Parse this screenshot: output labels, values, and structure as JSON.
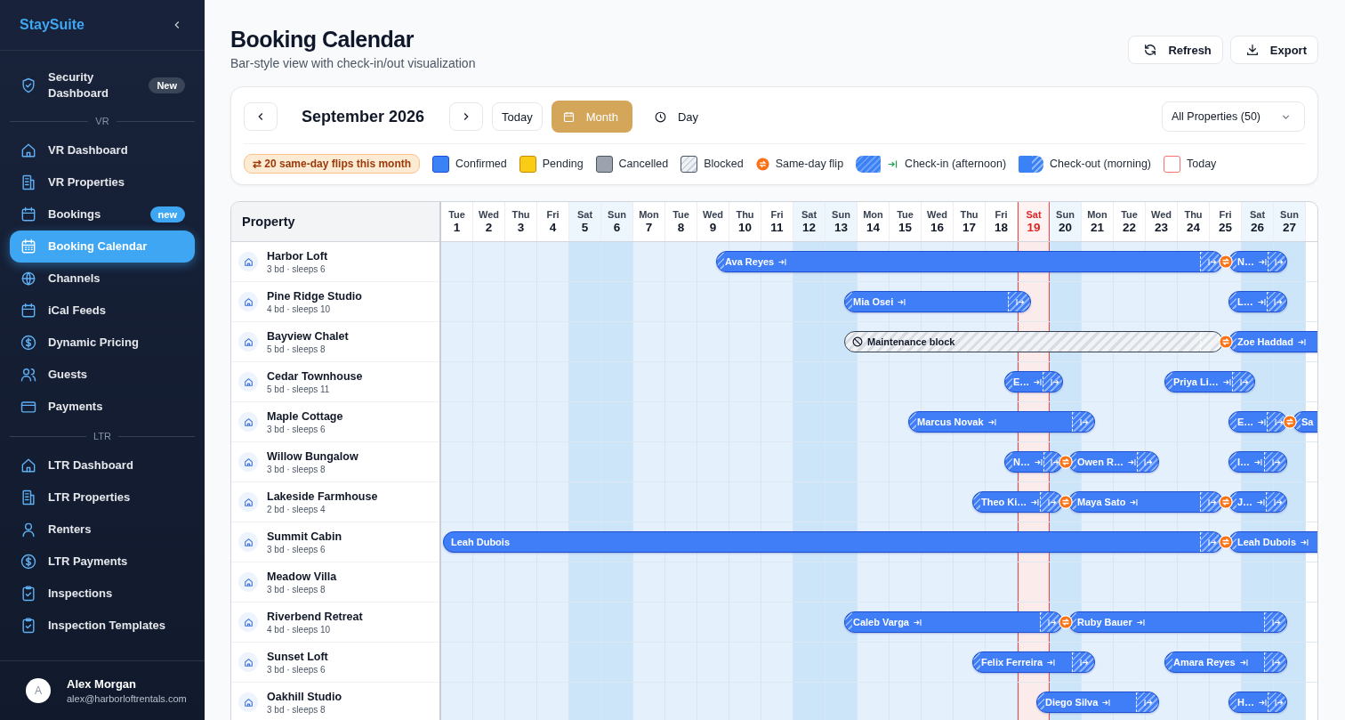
{
  "sidebar": {
    "brand": "StaySuite",
    "groups": [
      {
        "items": [
          {
            "label": "Security Dashboard",
            "selected": false,
            "badge": {
              "text": "New",
              "color": "#3a4558"
            }
          }
        ]
      },
      {
        "heading": "VR",
        "items": [
          {
            "label": "VR Dashboard",
            "selected": false
          },
          {
            "label": "VR Properties",
            "selected": false
          },
          {
            "label": "Bookings",
            "selected": false,
            "badge": {
              "text": "new",
              "color": "#3ea6f2"
            }
          },
          {
            "label": "Booking Calendar",
            "selected": true
          },
          {
            "label": "Channels",
            "selected": false
          },
          {
            "label": "iCal Feeds",
            "selected": false
          },
          {
            "label": "Dynamic Pricing",
            "selected": false
          },
          {
            "label": "Guests",
            "selected": false
          },
          {
            "label": "Payments",
            "selected": false
          }
        ]
      },
      {
        "heading": "LTR",
        "items": [
          {
            "label": "LTR Dashboard",
            "selected": false
          },
          {
            "label": "LTR Properties",
            "selected": false
          },
          {
            "label": "Renters",
            "selected": false
          },
          {
            "label": "LTR Payments",
            "selected": false
          },
          {
            "label": "Inspections",
            "selected": false
          },
          {
            "label": "Inspection Templates",
            "selected": false
          }
        ]
      }
    ],
    "user": {
      "initial": "A",
      "name": "Alex Morgan",
      "email": "alex@harborloftrentals.com"
    }
  },
  "header": {
    "title": "Booking Calendar",
    "subtitle": "Bar-style view with check-in/out visualization",
    "actions": [
      "Refresh",
      "Export"
    ]
  },
  "toolbar": {
    "month": "September 2026",
    "today": "Today",
    "views": [
      {
        "label": "Month",
        "selected": true
      },
      {
        "label": "Day",
        "selected": false
      }
    ],
    "filter": "All Properties (50)",
    "flips": "⇄ 20 same-day flips this month",
    "legend": [
      {
        "kind": "confirmed",
        "label": "Confirmed"
      },
      {
        "kind": "pending",
        "label": "Pending"
      },
      {
        "kind": "cancelled",
        "label": "Cancelled"
      },
      {
        "kind": "blocked",
        "label": "Blocked"
      },
      {
        "kind": "flip",
        "label": "Same-day flip"
      },
      {
        "kind": "checkin",
        "label": "Check-in (afternoon)"
      },
      {
        "kind": "checkout",
        "label": "Check-out (morning)"
      },
      {
        "kind": "today",
        "label": "Today"
      }
    ]
  },
  "calendar": {
    "property_heading": "Property",
    "days": [
      {
        "dow": "Tue",
        "date": "1",
        "weekend": false,
        "today": false
      },
      {
        "dow": "Wed",
        "date": "2",
        "weekend": false,
        "today": false
      },
      {
        "dow": "Thu",
        "date": "3",
        "weekend": false,
        "today": false
      },
      {
        "dow": "Fri",
        "date": "4",
        "weekend": false,
        "today": false
      },
      {
        "dow": "Sat",
        "date": "5",
        "weekend": true,
        "today": false
      },
      {
        "dow": "Sun",
        "date": "6",
        "weekend": true,
        "today": false
      },
      {
        "dow": "Mon",
        "date": "7",
        "weekend": false,
        "today": false
      },
      {
        "dow": "Tue",
        "date": "8",
        "weekend": false,
        "today": false
      },
      {
        "dow": "Wed",
        "date": "9",
        "weekend": false,
        "today": false
      },
      {
        "dow": "Thu",
        "date": "10",
        "weekend": false,
        "today": false
      },
      {
        "dow": "Fri",
        "date": "11",
        "weekend": false,
        "today": false
      },
      {
        "dow": "Sat",
        "date": "12",
        "weekend": true,
        "today": false
      },
      {
        "dow": "Sun",
        "date": "13",
        "weekend": true,
        "today": false
      },
      {
        "dow": "Mon",
        "date": "14",
        "weekend": false,
        "today": false
      },
      {
        "dow": "Tue",
        "date": "15",
        "weekend": false,
        "today": false
      },
      {
        "dow": "Wed",
        "date": "16",
        "weekend": false,
        "today": false
      },
      {
        "dow": "Thu",
        "date": "17",
        "weekend": false,
        "today": false
      },
      {
        "dow": "Fri",
        "date": "18",
        "weekend": false,
        "today": false
      },
      {
        "dow": "Sat",
        "date": "19",
        "weekend": true,
        "today": true
      },
      {
        "dow": "Sun",
        "date": "20",
        "weekend": true,
        "today": false
      },
      {
        "dow": "Mon",
        "date": "21",
        "weekend": false,
        "today": false
      },
      {
        "dow": "Tue",
        "date": "22",
        "weekend": false,
        "today": false
      },
      {
        "dow": "Wed",
        "date": "23",
        "weekend": false,
        "today": false
      },
      {
        "dow": "Thu",
        "date": "24",
        "weekend": false,
        "today": false
      },
      {
        "dow": "Fri",
        "date": "25",
        "weekend": false,
        "today": false
      },
      {
        "dow": "Sat",
        "date": "26",
        "weekend": true,
        "today": false
      },
      {
        "dow": "Sun",
        "date": "27",
        "weekend": true,
        "today": false
      }
    ],
    "properties": [
      {
        "name": "Harbor Loft",
        "details": "3 bd · sleeps 6",
        "bookings": [
          {
            "guest": "Ava Reyes",
            "kind": "confirmed"
          },
          {
            "guest": "N…",
            "kind": "confirmed"
          }
        ],
        "cells": [
          {
            "kind": "none"
          },
          {
            "kind": "none"
          },
          {
            "kind": "none"
          },
          {
            "kind": "none"
          },
          {
            "kind": "none"
          },
          {
            "kind": "none"
          },
          {
            "kind": "none"
          },
          {
            "kind": "none"
          },
          {
            "kind": "check_in"
          },
          {
            "kind": "none"
          },
          {
            "kind": "none"
          },
          {
            "kind": "none"
          },
          {
            "kind": "none"
          },
          {
            "kind": "none"
          },
          {
            "kind": "none"
          },
          {
            "kind": "none"
          },
          {
            "kind": "none"
          },
          {
            "kind": "none"
          },
          {
            "kind": "none"
          },
          {
            "kind": "none"
          },
          {
            "kind": "none"
          },
          {
            "kind": "none"
          },
          {
            "kind": "none"
          },
          {
            "kind": "none"
          },
          {
            "kind": "turnover"
          },
          {
            "kind": "none"
          },
          {
            "kind": "check_out"
          }
        ]
      },
      {
        "name": "Pine Ridge Studio",
        "details": "4 bd · sleeps 10",
        "bookings": [
          {
            "guest": "Mia Osei",
            "kind": "confirmed"
          },
          {
            "guest": "L…",
            "kind": "confirmed"
          }
        ],
        "cells": [
          {
            "kind": "none"
          },
          {
            "kind": "none"
          },
          {
            "kind": "none"
          },
          {
            "kind": "none"
          },
          {
            "kind": "none"
          },
          {
            "kind": "none"
          },
          {
            "kind": "none"
          },
          {
            "kind": "none"
          },
          {
            "kind": "none"
          },
          {
            "kind": "none"
          },
          {
            "kind": "none"
          },
          {
            "kind": "none"
          },
          {
            "kind": "check_in"
          },
          {
            "kind": "none"
          },
          {
            "kind": "none"
          },
          {
            "kind": "none"
          },
          {
            "kind": "none"
          },
          {
            "kind": "none"
          },
          {
            "kind": "check_out"
          },
          {
            "kind": "none"
          },
          {
            "kind": "none"
          },
          {
            "kind": "none"
          },
          {
            "kind": "none"
          },
          {
            "kind": "none"
          },
          {
            "kind": "check_in"
          },
          {
            "kind": "none"
          },
          {
            "kind": "check_out"
          }
        ]
      },
      {
        "name": "Bayview Chalet",
        "details": "5 bd · sleeps 8",
        "bookings": [
          {
            "guest": "Maintenance block",
            "kind": "blocked"
          },
          {
            "guest": "Zoe Haddad",
            "kind": "confirmed"
          }
        ],
        "cells": [
          {
            "kind": "none"
          },
          {
            "kind": "none"
          },
          {
            "kind": "none"
          },
          {
            "kind": "none"
          },
          {
            "kind": "none"
          },
          {
            "kind": "none"
          },
          {
            "kind": "none"
          },
          {
            "kind": "none"
          },
          {
            "kind": "none"
          },
          {
            "kind": "none"
          },
          {
            "kind": "none"
          },
          {
            "kind": "none"
          },
          {
            "kind": "check_in"
          },
          {
            "kind": "none"
          },
          {
            "kind": "none"
          },
          {
            "kind": "none"
          },
          {
            "kind": "none"
          },
          {
            "kind": "none"
          },
          {
            "kind": "none"
          },
          {
            "kind": "none"
          },
          {
            "kind": "none"
          },
          {
            "kind": "none"
          },
          {
            "kind": "none"
          },
          {
            "kind": "none"
          },
          {
            "kind": "turnover"
          },
          {
            "kind": "none"
          },
          {
            "kind": "none"
          }
        ]
      },
      {
        "name": "Cedar Townhouse",
        "details": "5 bd · sleeps 11",
        "bookings": [
          {
            "guest": "E…",
            "kind": "confirmed"
          },
          {
            "guest": "Priya Li…",
            "kind": "confirmed"
          }
        ],
        "cells": [
          {
            "kind": "none"
          },
          {
            "kind": "none"
          },
          {
            "kind": "none"
          },
          {
            "kind": "none"
          },
          {
            "kind": "none"
          },
          {
            "kind": "none"
          },
          {
            "kind": "none"
          },
          {
            "kind": "none"
          },
          {
            "kind": "none"
          },
          {
            "kind": "none"
          },
          {
            "kind": "none"
          },
          {
            "kind": "none"
          },
          {
            "kind": "none"
          },
          {
            "kind": "none"
          },
          {
            "kind": "none"
          },
          {
            "kind": "none"
          },
          {
            "kind": "none"
          },
          {
            "kind": "check_in"
          },
          {
            "kind": "none"
          },
          {
            "kind": "check_out"
          },
          {
            "kind": "none"
          },
          {
            "kind": "none"
          },
          {
            "kind": "check_in"
          },
          {
            "kind": "none"
          },
          {
            "kind": "none"
          },
          {
            "kind": "check_out"
          },
          {
            "kind": "none"
          }
        ]
      },
      {
        "name": "Maple Cottage",
        "details": "3 bd · sleeps 6",
        "bookings": [
          {
            "guest": "Marcus Novak",
            "kind": "confirmed"
          },
          {
            "guest": "E…",
            "kind": "confirmed"
          },
          {
            "guest": "Sa",
            "kind": "confirmed"
          }
        ],
        "cells": [
          {
            "kind": "none"
          },
          {
            "kind": "none"
          },
          {
            "kind": "none"
          },
          {
            "kind": "none"
          },
          {
            "kind": "none"
          },
          {
            "kind": "none"
          },
          {
            "kind": "none"
          },
          {
            "kind": "none"
          },
          {
            "kind": "none"
          },
          {
            "kind": "none"
          },
          {
            "kind": "none"
          },
          {
            "kind": "none"
          },
          {
            "kind": "none"
          },
          {
            "kind": "none"
          },
          {
            "kind": "check_in"
          },
          {
            "kind": "none"
          },
          {
            "kind": "none"
          },
          {
            "kind": "none"
          },
          {
            "kind": "none"
          },
          {
            "kind": "none"
          },
          {
            "kind": "check_out"
          },
          {
            "kind": "none"
          },
          {
            "kind": "none"
          },
          {
            "kind": "none"
          },
          {
            "kind": "check_in"
          },
          {
            "kind": "none"
          },
          {
            "kind": "turnover"
          }
        ]
      },
      {
        "name": "Willow Bungalow",
        "details": "3 bd · sleeps 8",
        "bookings": [
          {
            "guest": "N…",
            "kind": "confirmed"
          },
          {
            "guest": "Owen R…",
            "kind": "confirmed"
          },
          {
            "guest": "I…",
            "kind": "confirmed"
          }
        ],
        "cells": [
          {
            "kind": "none"
          },
          {
            "kind": "none"
          },
          {
            "kind": "none"
          },
          {
            "kind": "none"
          },
          {
            "kind": "none"
          },
          {
            "kind": "none"
          },
          {
            "kind": "none"
          },
          {
            "kind": "none"
          },
          {
            "kind": "none"
          },
          {
            "kind": "none"
          },
          {
            "kind": "none"
          },
          {
            "kind": "none"
          },
          {
            "kind": "none"
          },
          {
            "kind": "none"
          },
          {
            "kind": "none"
          },
          {
            "kind": "none"
          },
          {
            "kind": "none"
          },
          {
            "kind": "check_in"
          },
          {
            "kind": "none"
          },
          {
            "kind": "turnover"
          },
          {
            "kind": "none"
          },
          {
            "kind": "none"
          },
          {
            "kind": "check_out"
          },
          {
            "kind": "none"
          },
          {
            "kind": "check_in"
          },
          {
            "kind": "none"
          },
          {
            "kind": "check_out"
          }
        ]
      },
      {
        "name": "Lakeside Farmhouse",
        "details": "2 bd · sleeps 4",
        "bookings": [
          {
            "guest": "Theo Ki…",
            "kind": "confirmed"
          },
          {
            "guest": "Maya Sato",
            "kind": "confirmed"
          },
          {
            "guest": "J…",
            "kind": "confirmed"
          }
        ],
        "cells": [
          {
            "kind": "none"
          },
          {
            "kind": "none"
          },
          {
            "kind": "none"
          },
          {
            "kind": "none"
          },
          {
            "kind": "none"
          },
          {
            "kind": "none"
          },
          {
            "kind": "none"
          },
          {
            "kind": "none"
          },
          {
            "kind": "none"
          },
          {
            "kind": "none"
          },
          {
            "kind": "none"
          },
          {
            "kind": "none"
          },
          {
            "kind": "none"
          },
          {
            "kind": "none"
          },
          {
            "kind": "none"
          },
          {
            "kind": "none"
          },
          {
            "kind": "check_in"
          },
          {
            "kind": "none"
          },
          {
            "kind": "none"
          },
          {
            "kind": "turnover"
          },
          {
            "kind": "none"
          },
          {
            "kind": "none"
          },
          {
            "kind": "none"
          },
          {
            "kind": "none"
          },
          {
            "kind": "turnover"
          },
          {
            "kind": "none"
          },
          {
            "kind": "check_out"
          }
        ]
      },
      {
        "name": "Summit Cabin",
        "details": "3 bd · sleeps 6",
        "bookings": [
          {
            "guest": "Leah Dubois",
            "kind": "confirmed"
          },
          {
            "guest": "Leah Dubois",
            "kind": "confirmed"
          }
        ],
        "cells": [
          {
            "kind": "ongoing"
          },
          {
            "kind": "none"
          },
          {
            "kind": "none"
          },
          {
            "kind": "none"
          },
          {
            "kind": "none"
          },
          {
            "kind": "none"
          },
          {
            "kind": "none"
          },
          {
            "kind": "none"
          },
          {
            "kind": "none"
          },
          {
            "kind": "none"
          },
          {
            "kind": "none"
          },
          {
            "kind": "none"
          },
          {
            "kind": "none"
          },
          {
            "kind": "none"
          },
          {
            "kind": "none"
          },
          {
            "kind": "none"
          },
          {
            "kind": "none"
          },
          {
            "kind": "none"
          },
          {
            "kind": "none"
          },
          {
            "kind": "none"
          },
          {
            "kind": "none"
          },
          {
            "kind": "none"
          },
          {
            "kind": "none"
          },
          {
            "kind": "none"
          },
          {
            "kind": "turnover"
          },
          {
            "kind": "none"
          },
          {
            "kind": "none"
          }
        ]
      },
      {
        "name": "Meadow Villa",
        "details": "3 bd · sleeps 8",
        "cells": [
          {
            "kind": "none"
          },
          {
            "kind": "none"
          },
          {
            "kind": "none"
          },
          {
            "kind": "none"
          },
          {
            "kind": "none"
          },
          {
            "kind": "none"
          },
          {
            "kind": "none"
          },
          {
            "kind": "none"
          },
          {
            "kind": "none"
          },
          {
            "kind": "none"
          },
          {
            "kind": "none"
          },
          {
            "kind": "none"
          },
          {
            "kind": "none"
          },
          {
            "kind": "none"
          },
          {
            "kind": "none"
          },
          {
            "kind": "none"
          },
          {
            "kind": "none"
          },
          {
            "kind": "none"
          },
          {
            "kind": "none"
          },
          {
            "kind": "none"
          },
          {
            "kind": "none"
          },
          {
            "kind": "none"
          },
          {
            "kind": "none"
          },
          {
            "kind": "none"
          },
          {
            "kind": "none"
          },
          {
            "kind": "none"
          },
          {
            "kind": "none"
          }
        ]
      },
      {
        "name": "Riverbend Retreat",
        "details": "4 bd · sleeps 10",
        "bookings": [
          {
            "guest": "Caleb Varga",
            "kind": "confirmed"
          },
          {
            "guest": "Ruby Bauer",
            "kind": "confirmed"
          }
        ],
        "cells": [
          {
            "kind": "none"
          },
          {
            "kind": "none"
          },
          {
            "kind": "none"
          },
          {
            "kind": "none"
          },
          {
            "kind": "none"
          },
          {
            "kind": "none"
          },
          {
            "kind": "none"
          },
          {
            "kind": "none"
          },
          {
            "kind": "none"
          },
          {
            "kind": "none"
          },
          {
            "kind": "none"
          },
          {
            "kind": "none"
          },
          {
            "kind": "check_in"
          },
          {
            "kind": "none"
          },
          {
            "kind": "none"
          },
          {
            "kind": "none"
          },
          {
            "kind": "none"
          },
          {
            "kind": "none"
          },
          {
            "kind": "none"
          },
          {
            "kind": "turnover"
          },
          {
            "kind": "none"
          },
          {
            "kind": "none"
          },
          {
            "kind": "none"
          },
          {
            "kind": "none"
          },
          {
            "kind": "none"
          },
          {
            "kind": "none"
          },
          {
            "kind": "check_out"
          }
        ]
      },
      {
        "name": "Sunset Loft",
        "details": "3 bd · sleeps 6",
        "bookings": [
          {
            "guest": "Felix Ferreira",
            "kind": "confirmed"
          },
          {
            "guest": "Amara Reyes",
            "kind": "confirmed"
          }
        ],
        "cells": [
          {
            "kind": "none"
          },
          {
            "kind": "none"
          },
          {
            "kind": "none"
          },
          {
            "kind": "none"
          },
          {
            "kind": "none"
          },
          {
            "kind": "none"
          },
          {
            "kind": "none"
          },
          {
            "kind": "none"
          },
          {
            "kind": "none"
          },
          {
            "kind": "none"
          },
          {
            "kind": "none"
          },
          {
            "kind": "none"
          },
          {
            "kind": "none"
          },
          {
            "kind": "none"
          },
          {
            "kind": "none"
          },
          {
            "kind": "none"
          },
          {
            "kind": "check_in"
          },
          {
            "kind": "none"
          },
          {
            "kind": "none"
          },
          {
            "kind": "none"
          },
          {
            "kind": "check_out"
          },
          {
            "kind": "none"
          },
          {
            "kind": "check_in"
          },
          {
            "kind": "none"
          },
          {
            "kind": "none"
          },
          {
            "kind": "none"
          },
          {
            "kind": "check_out"
          }
        ]
      },
      {
        "name": "Oakhill Studio",
        "details": "3 bd · sleeps 8",
        "bookings": [
          {
            "guest": "Diego Silva",
            "kind": "confirmed"
          },
          {
            "guest": "H…",
            "kind": "confirmed"
          }
        ],
        "cells": [
          {
            "kind": "none"
          },
          {
            "kind": "none"
          },
          {
            "kind": "none"
          },
          {
            "kind": "none"
          },
          {
            "kind": "none"
          },
          {
            "kind": "none"
          },
          {
            "kind": "none"
          },
          {
            "kind": "none"
          },
          {
            "kind": "none"
          },
          {
            "kind": "none"
          },
          {
            "kind": "none"
          },
          {
            "kind": "none"
          },
          {
            "kind": "none"
          },
          {
            "kind": "none"
          },
          {
            "kind": "none"
          },
          {
            "kind": "none"
          },
          {
            "kind": "none"
          },
          {
            "kind": "none"
          },
          {
            "kind": "check_in"
          },
          {
            "kind": "none"
          },
          {
            "kind": "none"
          },
          {
            "kind": "none"
          },
          {
            "kind": "check_out"
          },
          {
            "kind": "none"
          },
          {
            "kind": "check_in"
          },
          {
            "kind": "none"
          },
          {
            "kind": "check_out"
          }
        ]
      }
    ]
  }
}
